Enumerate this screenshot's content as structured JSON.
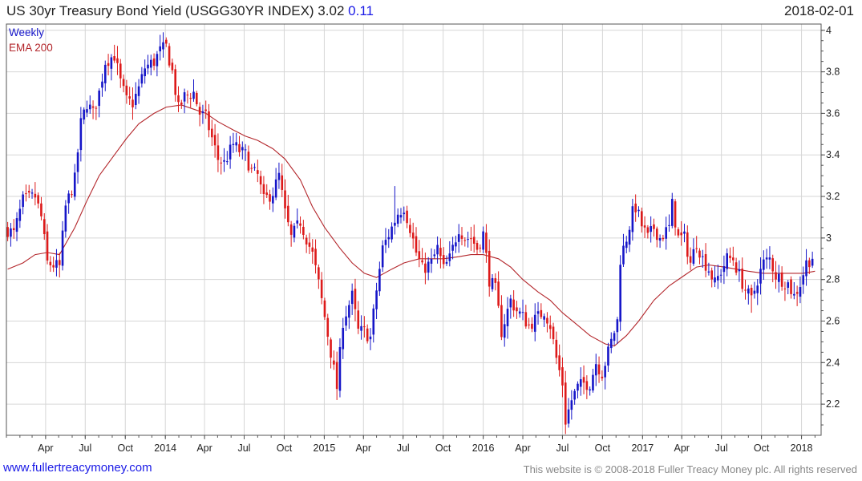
{
  "header": {
    "title": "US 30yr Treasury Bond Yield (USGG30YR INDEX) 3.02",
    "change": "0.11",
    "date": "2018-02-01"
  },
  "footer": {
    "site": "www.fullertreacymoney.com",
    "copyright": "This website is © 2008-2018 Fuller Treacy Money plc. All rights reserved"
  },
  "colors": {
    "up": "#1515c8",
    "down": "#dd1a1a",
    "ema": "#b3262b",
    "grid": "#d6d6d6",
    "frame": "#555555"
  },
  "chart_data": {
    "type": "candlestick",
    "legend": [
      {
        "label": "Weekly",
        "color": "#1515c8"
      },
      {
        "label": "EMA 200",
        "color": "#b3262b"
      }
    ],
    "legend_placement": "top-left",
    "ylim": [
      2.05,
      4.03
    ],
    "yticks": [
      "2.2",
      "2.4",
      "2.6",
      "2.8",
      "3",
      "3.2",
      "3.4",
      "3.6",
      "3.8",
      "4"
    ],
    "y_axis_side": "right",
    "grid": true,
    "xlim": [
      "2013-01-01",
      "2018-02-15"
    ],
    "xticks": [
      {
        "date": "2013-04-01",
        "label": "Apr"
      },
      {
        "date": "2013-07-01",
        "label": "Jul"
      },
      {
        "date": "2013-10-01",
        "label": "Oct"
      },
      {
        "date": "2014-01-01",
        "label": "2014"
      },
      {
        "date": "2014-04-01",
        "label": "Apr"
      },
      {
        "date": "2014-07-01",
        "label": "Jul"
      },
      {
        "date": "2014-10-01",
        "label": "Oct"
      },
      {
        "date": "2015-01-01",
        "label": "2015"
      },
      {
        "date": "2015-04-01",
        "label": "Apr"
      },
      {
        "date": "2015-07-01",
        "label": "Jul"
      },
      {
        "date": "2015-10-01",
        "label": "Oct"
      },
      {
        "date": "2016-01-01",
        "label": "2016"
      },
      {
        "date": "2016-04-01",
        "label": "Apr"
      },
      {
        "date": "2016-07-01",
        "label": "Jul"
      },
      {
        "date": "2016-10-01",
        "label": "Oct"
      },
      {
        "date": "2017-01-01",
        "label": "2017"
      },
      {
        "date": "2017-04-01",
        "label": "Apr"
      },
      {
        "date": "2017-07-01",
        "label": "Jul"
      },
      {
        "date": "2017-10-01",
        "label": "Oct"
      },
      {
        "date": "2018-01-01",
        "label": "2018"
      }
    ],
    "close_anchors": [
      [
        "2013-01-04",
        3.04
      ],
      [
        "2013-01-18",
        3.02
      ],
      [
        "2013-02-08",
        3.18
      ],
      [
        "2013-03-08",
        3.2
      ],
      [
        "2013-03-22",
        3.1
      ],
      [
        "2013-04-05",
        2.88
      ],
      [
        "2013-04-19",
        2.87
      ],
      [
        "2013-05-03",
        2.86
      ],
      [
        "2013-05-17",
        3.15
      ],
      [
        "2013-06-07",
        3.28
      ],
      [
        "2013-06-21",
        3.55
      ],
      [
        "2013-07-05",
        3.65
      ],
      [
        "2013-07-19",
        3.6
      ],
      [
        "2013-08-02",
        3.7
      ],
      [
        "2013-08-16",
        3.85
      ],
      [
        "2013-09-06",
        3.88
      ],
      [
        "2013-09-20",
        3.75
      ],
      [
        "2013-10-04",
        3.66
      ],
      [
        "2013-10-18",
        3.65
      ],
      [
        "2013-11-01",
        3.72
      ],
      [
        "2013-11-15",
        3.82
      ],
      [
        "2013-12-06",
        3.85
      ],
      [
        "2013-12-20",
        3.9
      ],
      [
        "2014-01-03",
        3.92
      ],
      [
        "2014-01-17",
        3.8
      ],
      [
        "2014-01-31",
        3.62
      ],
      [
        "2014-02-14",
        3.68
      ],
      [
        "2014-03-07",
        3.7
      ],
      [
        "2014-03-21",
        3.6
      ],
      [
        "2014-04-04",
        3.58
      ],
      [
        "2014-04-18",
        3.48
      ],
      [
        "2014-05-02",
        3.38
      ],
      [
        "2014-05-16",
        3.36
      ],
      [
        "2014-06-06",
        3.45
      ],
      [
        "2014-06-20",
        3.42
      ],
      [
        "2014-07-04",
        3.4
      ],
      [
        "2014-07-18",
        3.32
      ],
      [
        "2014-08-01",
        3.3
      ],
      [
        "2014-08-15",
        3.18
      ],
      [
        "2014-09-05",
        3.22
      ],
      [
        "2014-09-19",
        3.3
      ],
      [
        "2014-10-03",
        3.12
      ],
      [
        "2014-10-17",
        3.0
      ],
      [
        "2014-11-07",
        3.08
      ],
      [
        "2014-11-21",
        3.0
      ],
      [
        "2014-12-05",
        2.92
      ],
      [
        "2014-12-19",
        2.78
      ],
      [
        "2015-01-02",
        2.62
      ],
      [
        "2015-01-16",
        2.45
      ],
      [
        "2015-01-30",
        2.28
      ],
      [
        "2015-02-13",
        2.6
      ],
      [
        "2015-03-06",
        2.72
      ],
      [
        "2015-03-20",
        2.55
      ],
      [
        "2015-04-03",
        2.55
      ],
      [
        "2015-04-17",
        2.52
      ],
      [
        "2015-05-01",
        2.75
      ],
      [
        "2015-05-15",
        2.95
      ],
      [
        "2015-06-05",
        3.05
      ],
      [
        "2015-06-19",
        3.12
      ],
      [
        "2015-07-03",
        3.15
      ],
      [
        "2015-07-17",
        3.05
      ],
      [
        "2015-07-31",
        2.93
      ],
      [
        "2015-08-14",
        2.85
      ],
      [
        "2015-09-04",
        2.88
      ],
      [
        "2015-09-18",
        2.95
      ],
      [
        "2015-10-02",
        2.85
      ],
      [
        "2015-10-16",
        2.9
      ],
      [
        "2015-11-06",
        3.05
      ],
      [
        "2015-11-20",
        3.0
      ],
      [
        "2015-12-04",
        3.0
      ],
      [
        "2015-12-18",
        2.95
      ],
      [
        "2016-01-01",
        3.02
      ],
      [
        "2016-01-15",
        2.8
      ],
      [
        "2016-01-29",
        2.75
      ],
      [
        "2016-02-12",
        2.55
      ],
      [
        "2016-03-04",
        2.7
      ],
      [
        "2016-03-18",
        2.65
      ],
      [
        "2016-04-01",
        2.62
      ],
      [
        "2016-04-15",
        2.58
      ],
      [
        "2016-05-06",
        2.62
      ],
      [
        "2016-05-20",
        2.65
      ],
      [
        "2016-06-03",
        2.58
      ],
      [
        "2016-06-17",
        2.42
      ],
      [
        "2016-07-01",
        2.3
      ],
      [
        "2016-07-08",
        2.12
      ],
      [
        "2016-07-22",
        2.22
      ],
      [
        "2016-08-05",
        2.28
      ],
      [
        "2016-08-19",
        2.3
      ],
      [
        "2016-09-02",
        2.3
      ],
      [
        "2016-09-16",
        2.4
      ],
      [
        "2016-09-30",
        2.35
      ],
      [
        "2016-10-14",
        2.45
      ],
      [
        "2016-10-28",
        2.55
      ],
      [
        "2016-11-04",
        2.6
      ],
      [
        "2016-11-11",
        2.9
      ],
      [
        "2016-11-25",
        3.0
      ],
      [
        "2016-12-09",
        3.12
      ],
      [
        "2016-12-16",
        3.15
      ],
      [
        "2016-12-30",
        3.06
      ],
      [
        "2017-01-13",
        3.0
      ],
      [
        "2017-01-27",
        3.05
      ],
      [
        "2017-02-10",
        3.0
      ],
      [
        "2017-03-03",
        3.05
      ],
      [
        "2017-03-10",
        3.16
      ],
      [
        "2017-03-24",
        3.0
      ],
      [
        "2017-04-07",
        3.0
      ],
      [
        "2017-04-21",
        2.88
      ],
      [
        "2017-05-05",
        2.98
      ],
      [
        "2017-05-19",
        2.9
      ],
      [
        "2017-06-02",
        2.85
      ],
      [
        "2017-06-16",
        2.78
      ],
      [
        "2017-06-30",
        2.84
      ],
      [
        "2017-07-14",
        2.9
      ],
      [
        "2017-07-28",
        2.9
      ],
      [
        "2017-08-11",
        2.82
      ],
      [
        "2017-08-25",
        2.75
      ],
      [
        "2017-09-08",
        2.7
      ],
      [
        "2017-09-22",
        2.8
      ],
      [
        "2017-10-06",
        2.88
      ],
      [
        "2017-10-20",
        2.9
      ],
      [
        "2017-11-03",
        2.82
      ],
      [
        "2017-11-17",
        2.8
      ],
      [
        "2017-12-01",
        2.78
      ],
      [
        "2017-12-15",
        2.72
      ],
      [
        "2017-12-29",
        2.78
      ],
      [
        "2018-01-12",
        2.88
      ],
      [
        "2018-01-26",
        2.91
      ],
      [
        "2018-02-01",
        3.02
      ]
    ],
    "ema200_anchors": [
      [
        "2013-01-04",
        2.85
      ],
      [
        "2013-02-08",
        2.88
      ],
      [
        "2013-03-08",
        2.92
      ],
      [
        "2013-04-05",
        2.93
      ],
      [
        "2013-05-03",
        2.92
      ],
      [
        "2013-06-07",
        3.05
      ],
      [
        "2013-07-05",
        3.18
      ],
      [
        "2013-08-02",
        3.3
      ],
      [
        "2013-09-06",
        3.4
      ],
      [
        "2013-10-04",
        3.48
      ],
      [
        "2013-11-01",
        3.55
      ],
      [
        "2013-12-06",
        3.6
      ],
      [
        "2014-01-03",
        3.63
      ],
      [
        "2014-02-07",
        3.64
      ],
      [
        "2014-03-07",
        3.62
      ],
      [
        "2014-04-04",
        3.6
      ],
      [
        "2014-05-02",
        3.56
      ],
      [
        "2014-06-06",
        3.52
      ],
      [
        "2014-07-04",
        3.49
      ],
      [
        "2014-08-01",
        3.47
      ],
      [
        "2014-09-05",
        3.43
      ],
      [
        "2014-10-03",
        3.38
      ],
      [
        "2014-11-07",
        3.28
      ],
      [
        "2014-12-05",
        3.15
      ],
      [
        "2015-01-02",
        3.05
      ],
      [
        "2015-02-06",
        2.95
      ],
      [
        "2015-03-06",
        2.88
      ],
      [
        "2015-04-03",
        2.83
      ],
      [
        "2015-05-01",
        2.81
      ],
      [
        "2015-06-05",
        2.85
      ],
      [
        "2015-07-03",
        2.88
      ],
      [
        "2015-08-07",
        2.9
      ],
      [
        "2015-09-04",
        2.9
      ],
      [
        "2015-10-02",
        2.9
      ],
      [
        "2015-11-06",
        2.91
      ],
      [
        "2015-12-04",
        2.92
      ],
      [
        "2016-01-01",
        2.92
      ],
      [
        "2016-02-05",
        2.9
      ],
      [
        "2016-03-04",
        2.86
      ],
      [
        "2016-04-01",
        2.8
      ],
      [
        "2016-05-06",
        2.74
      ],
      [
        "2016-06-03",
        2.7
      ],
      [
        "2016-07-01",
        2.64
      ],
      [
        "2016-08-05",
        2.58
      ],
      [
        "2016-09-02",
        2.53
      ],
      [
        "2016-10-07",
        2.49
      ],
      [
        "2016-10-28",
        2.48
      ],
      [
        "2016-11-25",
        2.53
      ],
      [
        "2016-12-23",
        2.6
      ],
      [
        "2017-01-27",
        2.7
      ],
      [
        "2017-03-03",
        2.77
      ],
      [
        "2017-04-07",
        2.82
      ],
      [
        "2017-05-05",
        2.86
      ],
      [
        "2017-06-02",
        2.87
      ],
      [
        "2017-07-07",
        2.86
      ],
      [
        "2017-08-04",
        2.85
      ],
      [
        "2017-09-01",
        2.84
      ],
      [
        "2017-10-06",
        2.83
      ],
      [
        "2017-11-03",
        2.83
      ],
      [
        "2017-12-01",
        2.83
      ],
      [
        "2018-01-05",
        2.83
      ],
      [
        "2018-02-01",
        2.84
      ]
    ],
    "notable_lows": [
      [
        "2013-05-03",
        2.81
      ],
      [
        "2015-01-30",
        2.22
      ],
      [
        "2016-07-08",
        2.1
      ],
      [
        "2017-09-08",
        2.64
      ]
    ],
    "notable_highs": [
      [
        "2013-12-27",
        3.97
      ],
      [
        "2015-06-12",
        3.25
      ],
      [
        "2016-12-16",
        3.21
      ],
      [
        "2017-03-10",
        3.21
      ]
    ]
  }
}
